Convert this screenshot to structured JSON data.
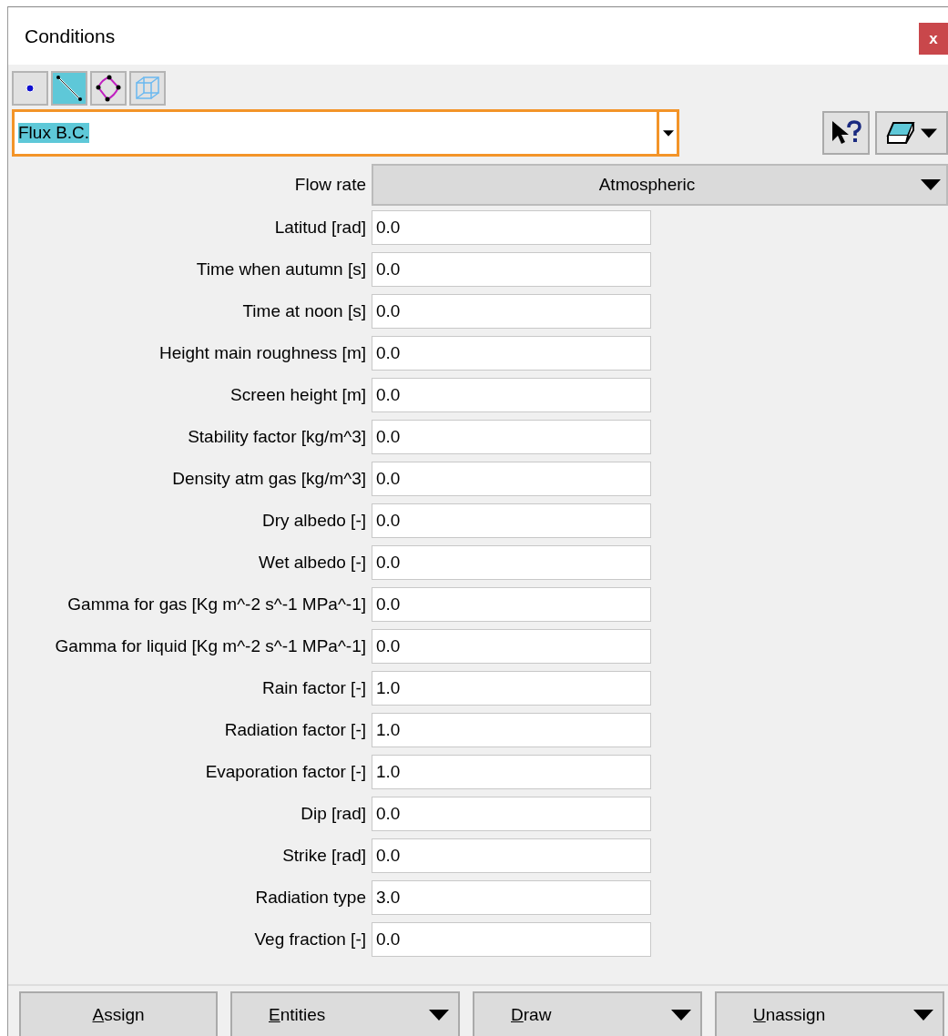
{
  "window": {
    "title": "Conditions",
    "close": "x"
  },
  "entity_types": [
    {
      "kind": "point",
      "selected": false
    },
    {
      "kind": "line",
      "selected": true
    },
    {
      "kind": "surface",
      "selected": false
    },
    {
      "kind": "volume",
      "selected": false
    }
  ],
  "condition_select": {
    "value": "Flux B.C."
  },
  "flow_rate": {
    "label": "Flow rate",
    "value": "Atmospheric"
  },
  "fields": [
    {
      "label": "Latitud [rad]",
      "value": "0.0"
    },
    {
      "label": "Time when autumn [s]",
      "value": "0.0"
    },
    {
      "label": "Time at noon [s]",
      "value": "0.0"
    },
    {
      "label": "Height main roughness [m]",
      "value": "0.0"
    },
    {
      "label": "Screen height [m]",
      "value": "0.0"
    },
    {
      "label": "Stability factor [kg/m^3]",
      "value": "0.0"
    },
    {
      "label": "Density atm gas [kg/m^3]",
      "value": "0.0"
    },
    {
      "label": "Dry albedo [-]",
      "value": "0.0"
    },
    {
      "label": "Wet albedo [-]",
      "value": "0.0"
    },
    {
      "label": "Gamma for gas [Kg m^-2 s^-1 MPa^-1]",
      "value": "0.0"
    },
    {
      "label": "Gamma for liquid [Kg m^-2 s^-1 MPa^-1]",
      "value": "0.0"
    },
    {
      "label": "Rain factor [-]",
      "value": "1.0"
    },
    {
      "label": "Radiation factor [-]",
      "value": "1.0"
    },
    {
      "label": "Evaporation factor [-]",
      "value": "1.0"
    },
    {
      "label": "Dip [rad]",
      "value": "0.0"
    },
    {
      "label": "Strike [rad]",
      "value": "0.0"
    },
    {
      "label": "Radiation type",
      "value": "3.0"
    },
    {
      "label": "Veg fraction [-]",
      "value": "0.0"
    }
  ],
  "buttons": [
    {
      "label": "Assign",
      "has_menu": false
    },
    {
      "label": "Entities",
      "has_menu": true
    },
    {
      "label": "Draw",
      "has_menu": true
    },
    {
      "label": "Unassign",
      "has_menu": true
    }
  ]
}
